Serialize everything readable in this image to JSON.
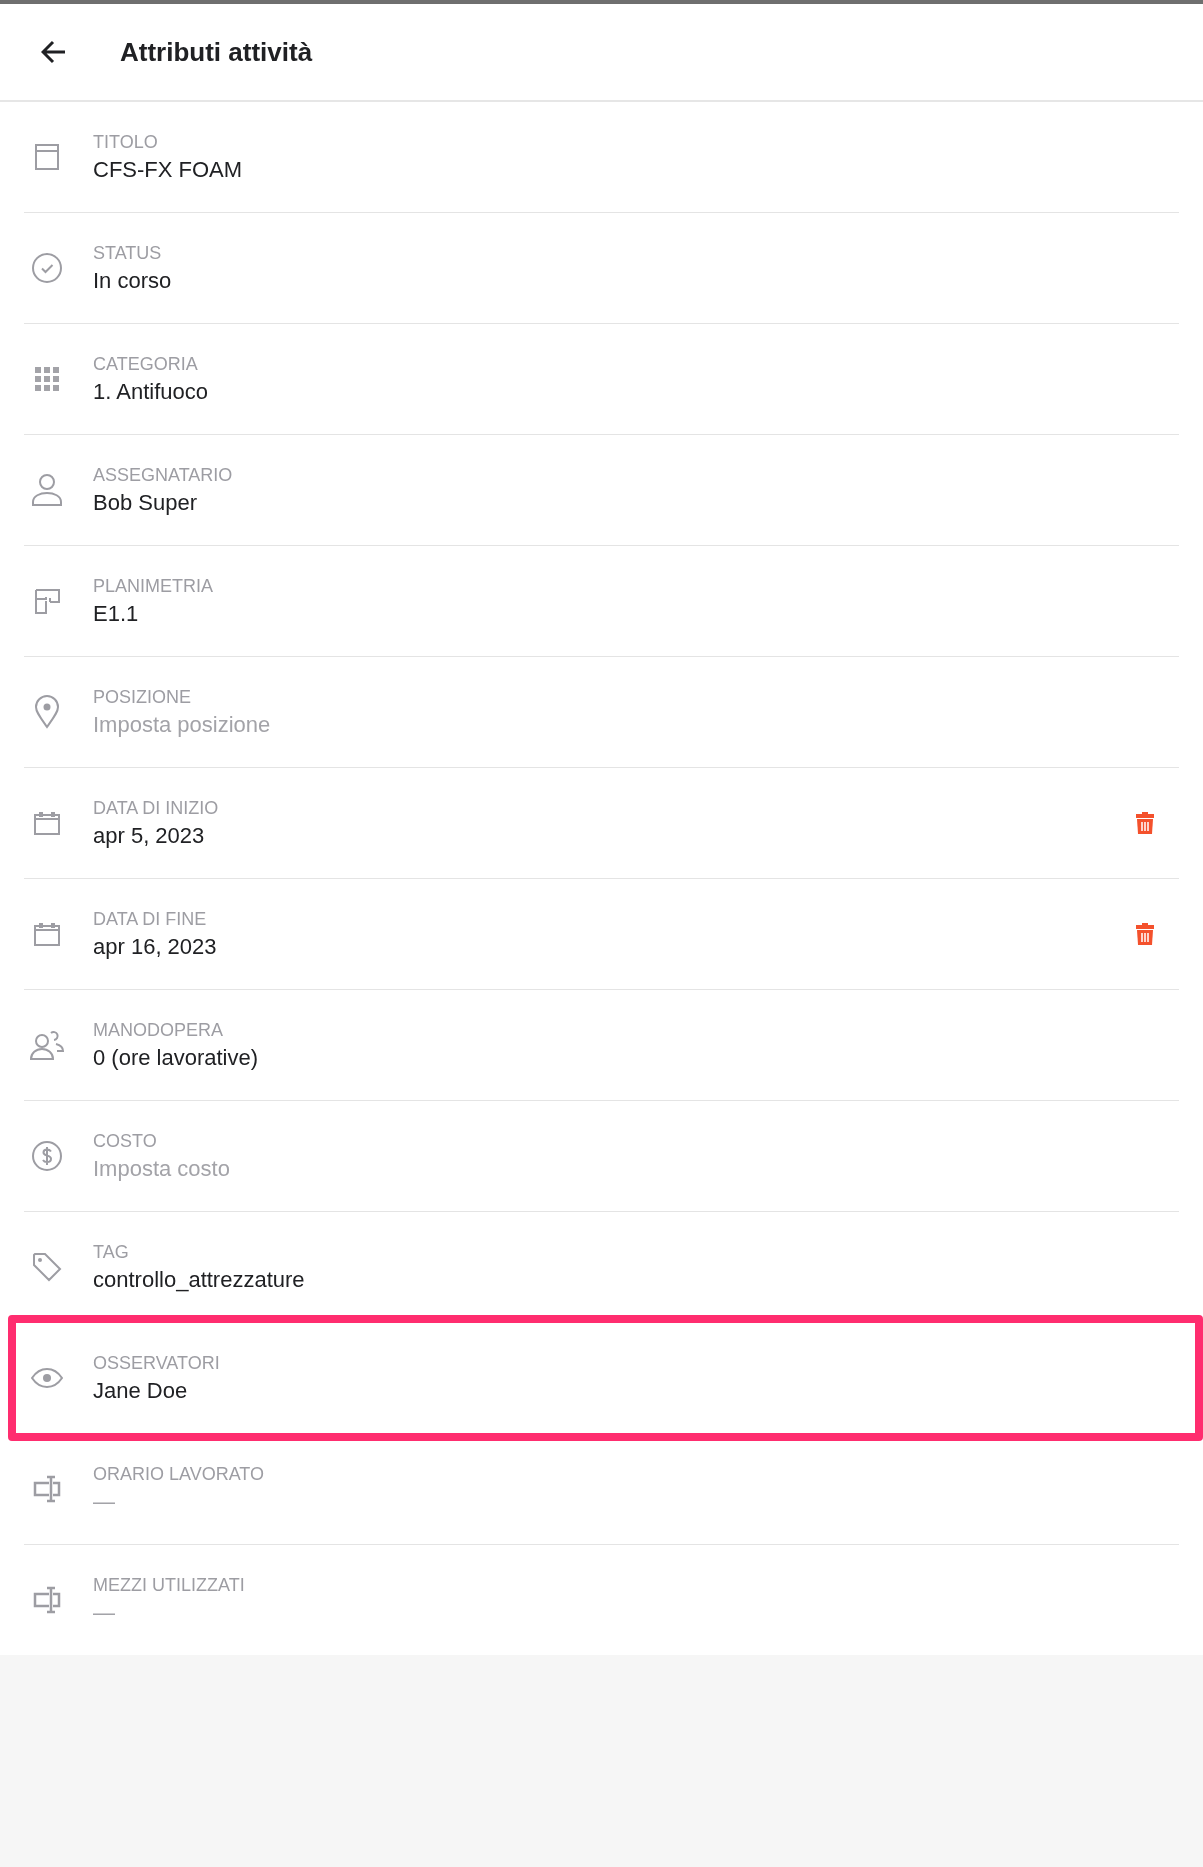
{
  "header": {
    "title": "Attributi attività"
  },
  "fields": [
    {
      "kind": "title",
      "label": "TITOLO",
      "value": "CFS-FX FOAM",
      "deletable": false,
      "highlighted": false
    },
    {
      "kind": "status",
      "label": "STATUS",
      "value": "In corso",
      "deletable": false,
      "highlighted": false
    },
    {
      "kind": "category",
      "label": "CATEGORIA",
      "value": "1. Antifuoco",
      "deletable": false,
      "highlighted": false
    },
    {
      "kind": "person",
      "label": "ASSEGNATARIO",
      "value": "Bob Super",
      "deletable": false,
      "highlighted": false
    },
    {
      "kind": "floorplan",
      "label": "PLANIMETRIA",
      "value": "E1.1",
      "deletable": false,
      "highlighted": false
    },
    {
      "kind": "pin",
      "label": "POSIZIONE",
      "placeholder": "Imposta posizione",
      "deletable": false,
      "highlighted": false
    },
    {
      "kind": "calendar",
      "label": "DATA DI INIZIO",
      "value": "apr 5, 2023",
      "deletable": true,
      "highlighted": false
    },
    {
      "kind": "calendar",
      "label": "DATA DI FINE",
      "value": "apr 16, 2023",
      "deletable": true,
      "highlighted": false
    },
    {
      "kind": "people",
      "label": "MANODOPERA",
      "value": "0 (ore lavorative)",
      "deletable": false,
      "highlighted": false
    },
    {
      "kind": "dollar",
      "label": "COSTO",
      "placeholder": "Imposta costo",
      "deletable": false,
      "highlighted": false
    },
    {
      "kind": "tag",
      "label": "TAG",
      "value": "controllo_attrezzature",
      "deletable": false,
      "highlighted": false
    },
    {
      "kind": "eye",
      "label": "OSSERVATORI",
      "value": "Jane Doe",
      "deletable": false,
      "highlighted": true
    },
    {
      "kind": "textfield",
      "label": "ORARIO LAVORATO",
      "placeholder": "—",
      "deletable": false,
      "highlighted": false
    },
    {
      "kind": "textfield",
      "label": "MEZZI UTILIZZATI",
      "placeholder": "—",
      "deletable": false,
      "highlighted": false
    }
  ]
}
